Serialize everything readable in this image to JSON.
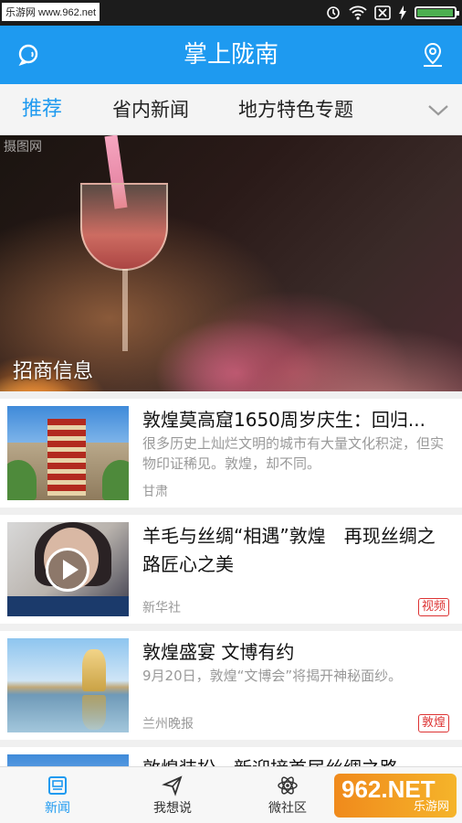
{
  "status_bar": {
    "watermark": "乐游网 www.962.net",
    "battery_level": 0.92,
    "accent": "#1e9af0"
  },
  "header": {
    "title": "掌上陇南",
    "left_icon": "search-chat-icon",
    "right_icon": "location-pin-icon"
  },
  "tabs": [
    {
      "label": "推荐",
      "active": true
    },
    {
      "label": "省内新闻",
      "active": false
    },
    {
      "label": "地方特色专题",
      "active": false
    }
  ],
  "banner": {
    "caption": "招商信息",
    "watermark": "摄图网"
  },
  "news": [
    {
      "title": "敦煌莫高窟1650周岁庆生：回归...",
      "desc": "很多历史上灿烂文明的城市有大量文化积淀，但实物印证稀见。敦煌，却不同。",
      "source": "甘肃",
      "tag": ""
    },
    {
      "title": "羊毛与丝绸“相遇”敦煌　再现丝绸之路匠心之美",
      "desc": "",
      "source": "新华社",
      "tag": "视频"
    },
    {
      "title": "敦煌盛宴 文博有约",
      "desc": "9月20日，敦煌“文博会”将揭开神秘面纱。",
      "source": "兰州晚报",
      "tag": "敦煌"
    },
    {
      "title": "敦煌装扮，新迎接首届丝绸之路...",
      "desc": "",
      "source": "",
      "tag": ""
    }
  ],
  "bottom_nav": [
    {
      "label": "新闻",
      "icon": "news-icon",
      "active": true
    },
    {
      "label": "我想说",
      "icon": "send-icon",
      "active": false
    },
    {
      "label": "微社区",
      "icon": "atom-icon",
      "active": false
    }
  ],
  "corner_watermark": {
    "big": "962.NET",
    "small": "乐游网"
  }
}
